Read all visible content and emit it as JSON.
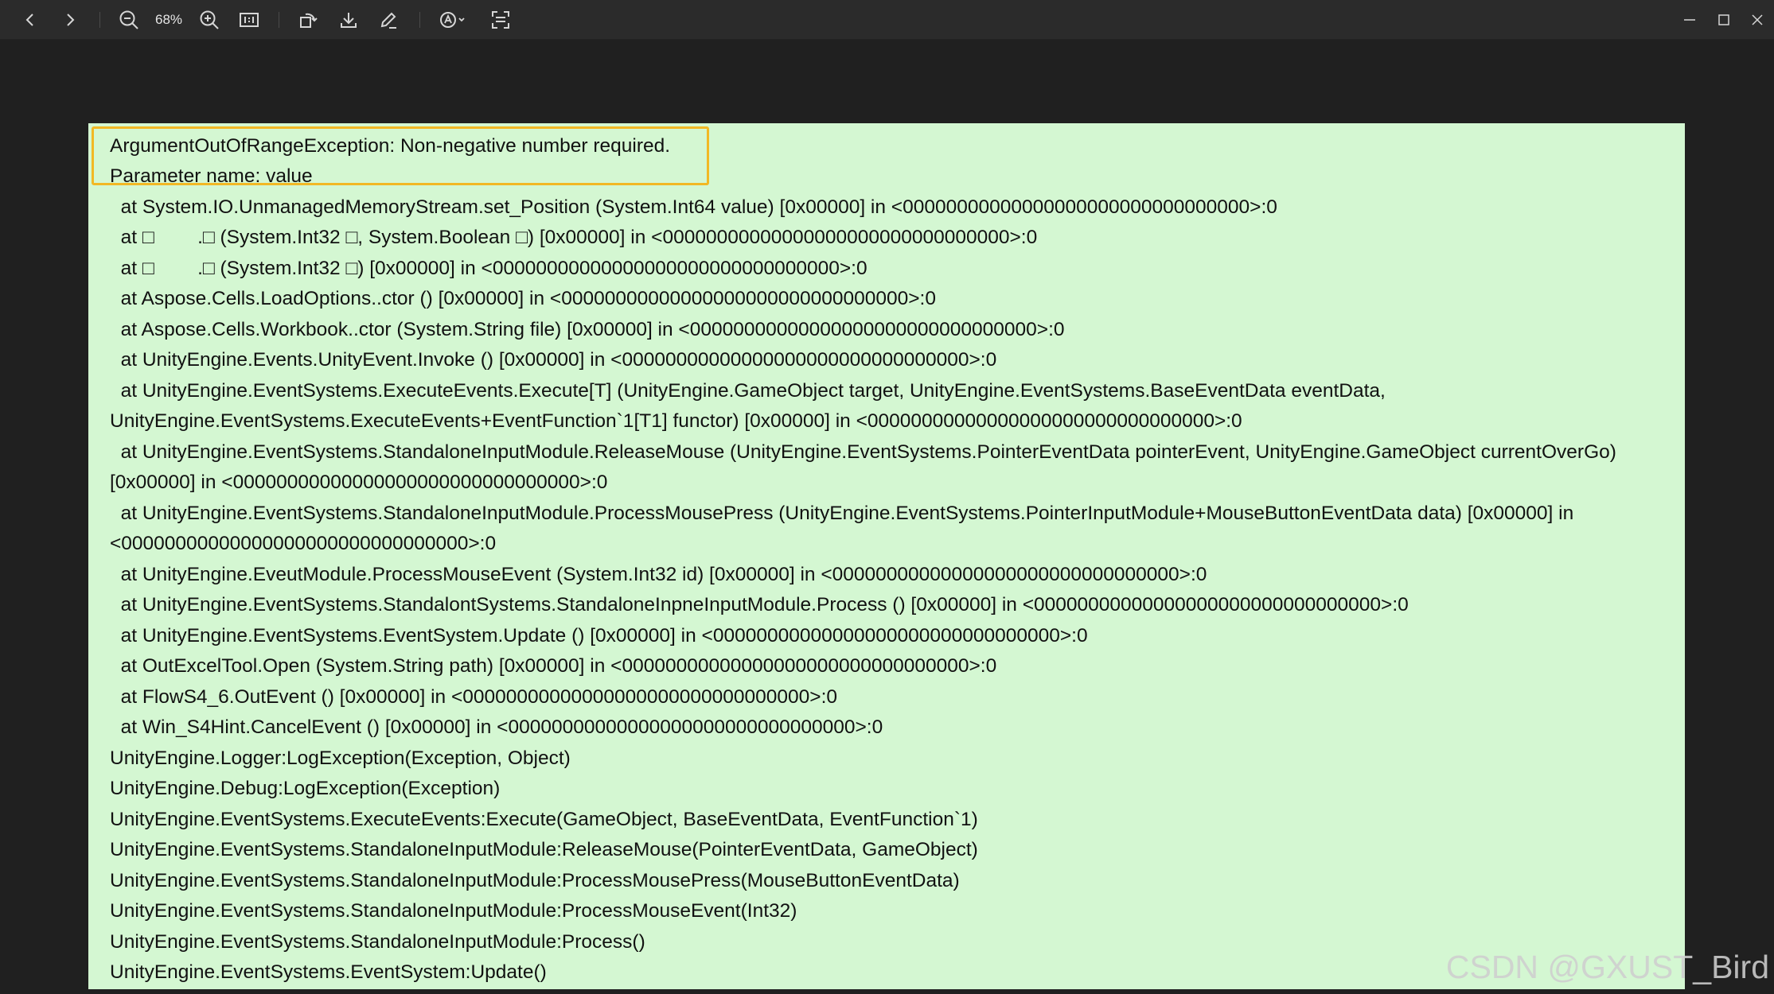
{
  "toolbar": {
    "zoom_level": "68%",
    "icons": {
      "back": "chevron-left-icon",
      "forward": "chevron-right-icon",
      "zoom_out": "zoom-out-icon",
      "zoom_in": "zoom-in-icon",
      "actual_size": "actual-size-icon",
      "rotate": "rotate-icon",
      "download": "download-icon",
      "edit": "pencil-icon",
      "annotate": "annotate-icon",
      "scan": "scan-text-icon",
      "minimize": "minimize-icon",
      "maximize": "maximize-icon",
      "close": "close-icon"
    }
  },
  "colors": {
    "toolbar_bg": "#2b2b2b",
    "canvas_bg": "#202020",
    "document_bg": "#d4f7d2",
    "highlight_border": "#f2b824"
  },
  "log": {
    "lines": [
      "ArgumentOutOfRangeException: Non-negative number required.",
      "Parameter name: value",
      "  at System.IO.UnmanagedMemoryStream.set_Position (System.Int64 value) [0x00000] in <00000000000000000000000000000000>:0",
      "  at □        .□ (System.Int32 □, System.Boolean □) [0x00000] in <00000000000000000000000000000000>:0",
      "  at □        .□ (System.Int32 □) [0x00000] in <00000000000000000000000000000000>:0",
      "  at Aspose.Cells.LoadOptions..ctor () [0x00000] in <00000000000000000000000000000000>:0",
      "  at Aspose.Cells.Workbook..ctor (System.String file) [0x00000] in <00000000000000000000000000000000>:0",
      "  at UnityEngine.Events.UnityEvent.Invoke () [0x00000] in <00000000000000000000000000000000>:0",
      "  at UnityEngine.EventSystems.ExecuteEvents.Execute[T] (UnityEngine.GameObject target, UnityEngine.EventSystems.BaseEventData eventData,",
      "UnityEngine.EventSystems.ExecuteEvents+EventFunction`1[T1] functor) [0x00000] in <00000000000000000000000000000000>:0",
      "  at UnityEngine.EventSystems.StandaloneInputModule.ReleaseMouse (UnityEngine.EventSystems.PointerEventData pointerEvent, UnityEngine.GameObject currentOverGo)",
      "[0x00000] in <00000000000000000000000000000000>:0",
      "  at UnityEngine.EventSystems.StandaloneInputModule.ProcessMousePress (UnityEngine.EventSystems.PointerInputModule+MouseButtonEventData data) [0x00000] in",
      "<00000000000000000000000000000000>:0",
      "  at UnityEngine.EveutModule.ProcessMouseEvent (System.Int32 id) [0x00000] in <00000000000000000000000000000000>:0",
      "  at UnityEngine.EventSystems.StandalontSystems.StandaloneInpneInputModule.Process () [0x00000] in <00000000000000000000000000000000>:0",
      "  at UnityEngine.EventSystems.EventSystem.Update () [0x00000] in <00000000000000000000000000000000>:0",
      "  at OutExcelTool.Open (System.String path) [0x00000] in <00000000000000000000000000000000>:0",
      "  at FlowS4_6.OutEvent () [0x00000] in <00000000000000000000000000000000>:0",
      "  at Win_S4Hint.CancelEvent () [0x00000] in <00000000000000000000000000000000>:0",
      "UnityEngine.Logger:LogException(Exception, Object)",
      "UnityEngine.Debug:LogException(Exception)",
      "UnityEngine.EventSystems.ExecuteEvents:Execute(GameObject, BaseEventData, EventFunction`1)",
      "UnityEngine.EventSystems.StandaloneInputModule:ReleaseMouse(PointerEventData, GameObject)",
      "UnityEngine.EventSystems.StandaloneInputModule:ProcessMousePress(MouseButtonEventData)",
      "UnityEngine.EventSystems.StandaloneInputModule:ProcessMouseEvent(Int32)",
      "UnityEngine.EventSystems.StandaloneInputModule:Process()",
      "UnityEngine.EventSystems.EventSystem:Update()"
    ]
  },
  "watermark": "CSDN @GXUST_Bird"
}
